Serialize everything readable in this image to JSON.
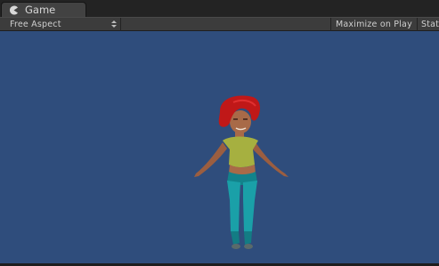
{
  "tab": {
    "label": "Game",
    "icon": "pacman-icon"
  },
  "toolbar": {
    "aspect": "Free Aspect",
    "maximize": "Maximize on Play",
    "stats": "Stat"
  },
  "colors": {
    "viewport_bg": "#2f4d7c",
    "hair": "#c01818",
    "top": "#a6b040",
    "pants": "#1aa0a8",
    "skin": "#a86a48"
  }
}
